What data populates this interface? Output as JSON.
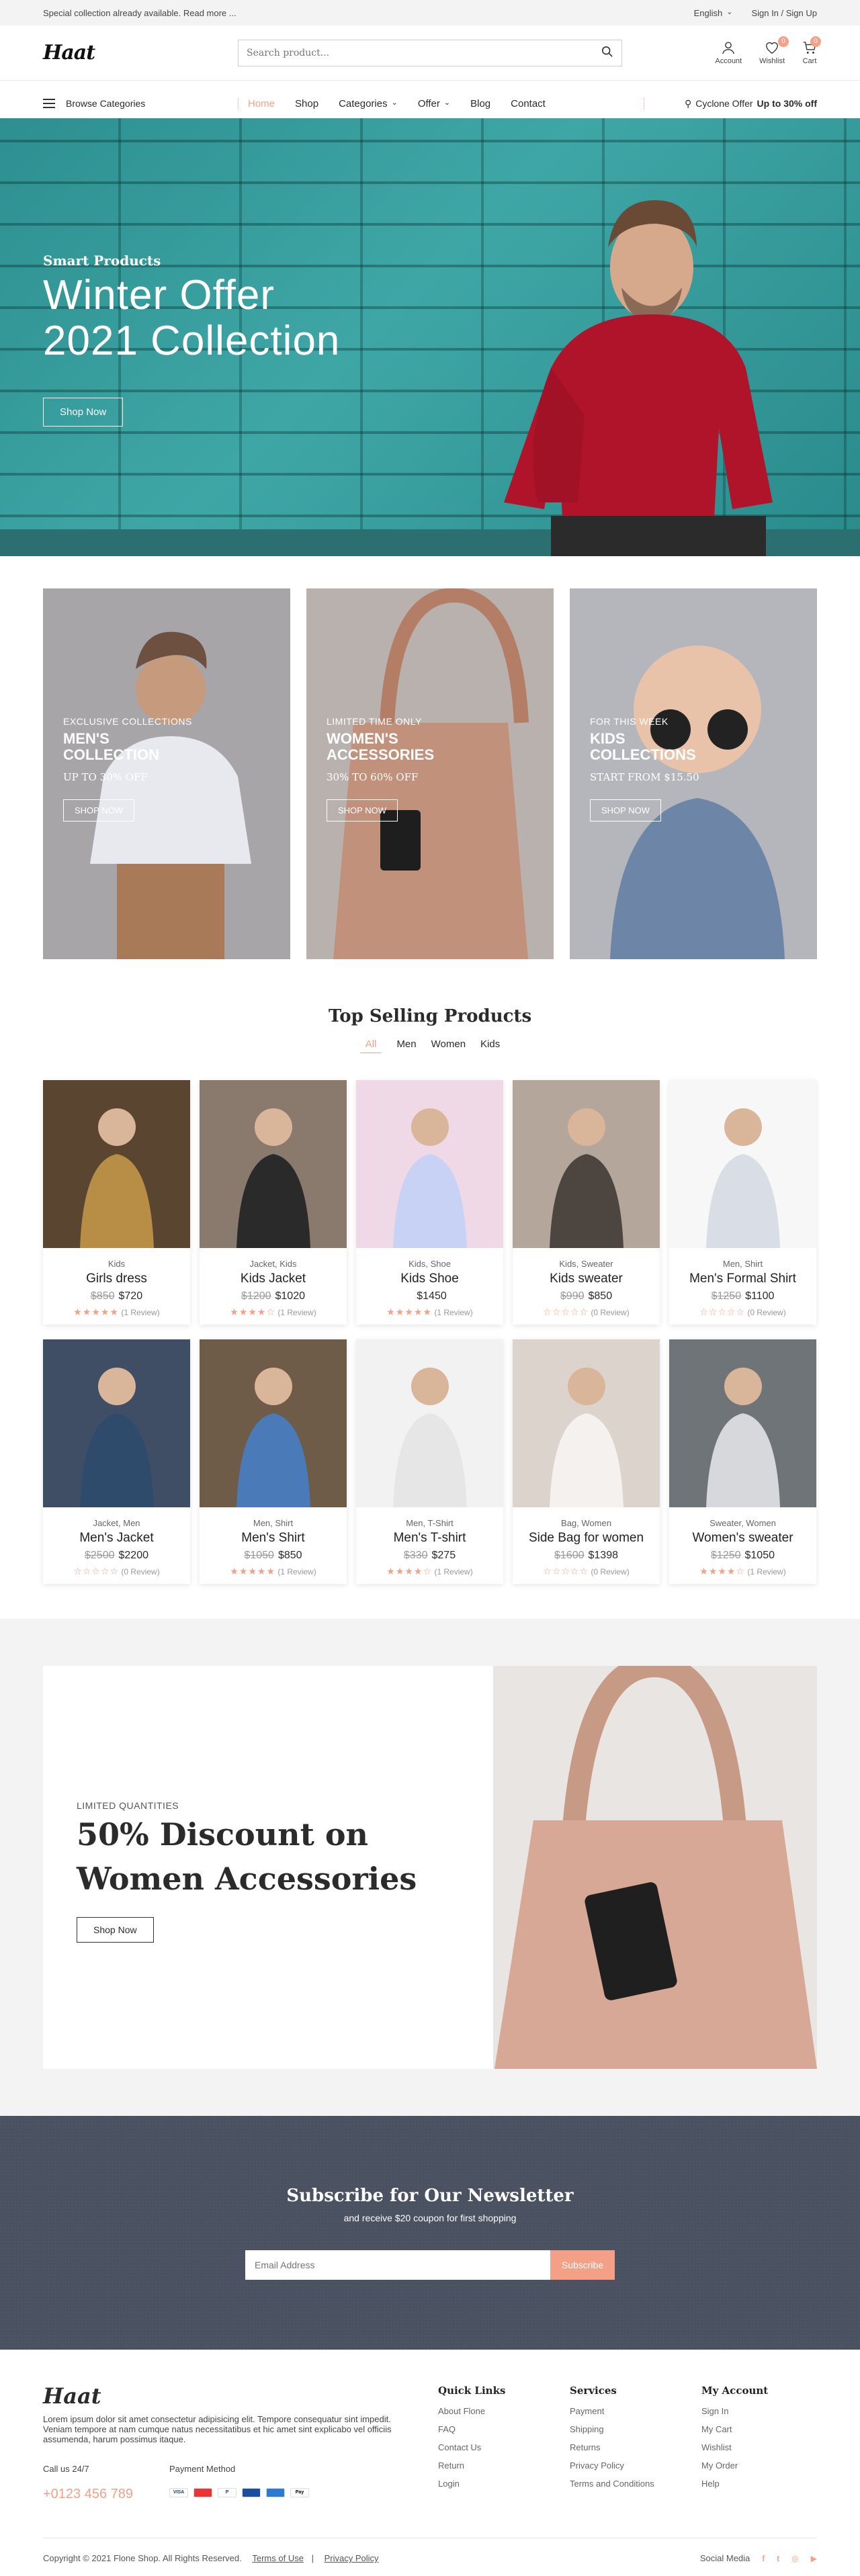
{
  "topbar": {
    "notice": "Special collection already available. Read more ...",
    "language": "English",
    "auth": "Sign In / Sign Up"
  },
  "header": {
    "logo": "Haat",
    "search_placeholder": "Search product...",
    "account": "Account",
    "wishlist": "Wishlist",
    "wishlist_count": "0",
    "cart": "Cart",
    "cart_count": "0"
  },
  "nav": {
    "browse": "Browse Categories",
    "items": [
      "Home",
      "Shop",
      "Categories",
      "Offer",
      "Blog",
      "Contact"
    ],
    "offer_prefix": "Cyclone Offer",
    "offer_strong": "Up to 30% off"
  },
  "hero": {
    "subtitle": "Smart Products",
    "title_line1": "Winter Offer",
    "title_line2": "2021 Collection",
    "button": "Shop Now"
  },
  "categories": [
    {
      "eyebrow": "EXCLUSIVE COLLECTIONS",
      "title": "MEN'S COLLECTION",
      "note": "UP TO 30% OFF",
      "button": "SHOP NOW"
    },
    {
      "eyebrow": "LIMITED TIME ONLY",
      "title": "WOMEN'S ACCESSORIES",
      "note": "30% TO 60% OFF",
      "button": "SHOP NOW"
    },
    {
      "eyebrow": "FOR THIS WEEK",
      "title": "KIDS COLLECTIONS",
      "note": "START FROM $15.50",
      "button": "SHOP NOW"
    }
  ],
  "top_selling": {
    "title": "Top Selling Products",
    "tabs": [
      "All",
      "Men",
      "Women",
      "Kids"
    ],
    "products": [
      {
        "category": "Kids",
        "name": "Girls dress",
        "old_price": "$850",
        "price": "$720",
        "stars": "★★★★★",
        "reviews": "(1 Review)"
      },
      {
        "category": "Jacket, Kids",
        "name": "Kids Jacket",
        "old_price": "$1200",
        "price": "$1020",
        "stars": "★★★★☆",
        "reviews": "(1 Review)"
      },
      {
        "category": "Kids, Shoe",
        "name": "Kids Shoe",
        "old_price": "",
        "price": "$1450",
        "stars": "★★★★★",
        "reviews": "(1 Review)"
      },
      {
        "category": "Kids, Sweater",
        "name": "Kids sweater",
        "old_price": "$990",
        "price": "$850",
        "stars": "☆☆☆☆☆",
        "reviews": "(0 Review)"
      },
      {
        "category": "Men, Shirt",
        "name": "Men's Formal Shirt",
        "old_price": "$1250",
        "price": "$1100",
        "stars": "☆☆☆☆☆",
        "reviews": "(0 Review)"
      },
      {
        "category": "Jacket, Men",
        "name": "Men's Jacket",
        "old_price": "$2500",
        "price": "$2200",
        "stars": "☆☆☆☆☆",
        "reviews": "(0 Review)"
      },
      {
        "category": "Men, Shirt",
        "name": "Men's Shirt",
        "old_price": "$1050",
        "price": "$850",
        "stars": "★★★★★",
        "reviews": "(1 Review)"
      },
      {
        "category": "Men, T-Shirt",
        "name": "Men's T-shirt",
        "old_price": "$330",
        "price": "$275",
        "stars": "★★★★☆",
        "reviews": "(1 Review)"
      },
      {
        "category": "Bag, Women",
        "name": "Side Bag for women",
        "old_price": "$1600",
        "price": "$1398",
        "stars": "☆☆☆☆☆",
        "reviews": "(0 Review)"
      },
      {
        "category": "Sweater, Women",
        "name": "Women's sweater",
        "old_price": "$1250",
        "price": "$1050",
        "stars": "★★★★☆",
        "reviews": "(1 Review)"
      }
    ]
  },
  "discount": {
    "eyebrow": "LIMITED QUANTITIES",
    "title_line1": "50% Discount on",
    "title_line2": "Women Accessories",
    "button": "Shop Now"
  },
  "newsletter": {
    "title": "Subscribe for Our Newsletter",
    "subtitle": "and receive $20 coupon for first shopping",
    "placeholder": "Email Address",
    "button": "Subscribe"
  },
  "footer": {
    "logo": "Haat",
    "about": "Lorem ipsum dolor sit amet consectetur adipisicing elit. Tempore consequatur sint impedit. Veniam tempore at nam cumque natus necessitatibus et hic amet sint explicabo vel officiis assumenda, harum possimus itaque.",
    "call_label": "Call us 24/7",
    "phone": "+0123 456 789",
    "payment_label": "Payment Method",
    "columns": [
      {
        "title": "Quick Links",
        "items": [
          "About Flone",
          "FAQ",
          "Contact Us",
          "Return",
          "Login"
        ]
      },
      {
        "title": "Services",
        "items": [
          "Payment",
          "Shipping",
          "Returns",
          "Privacy Policy",
          "Terms and Conditions"
        ]
      },
      {
        "title": "My Account",
        "items": [
          "Sign In",
          "My Cart",
          "Wishlist",
          "My Order",
          "Help"
        ]
      }
    ],
    "copyright": "Copyright © 2021 Flone Shop. All Rights Reserved.",
    "terms": "Terms of Use",
    "privacy": "Privacy Policy",
    "social_label": "Social Media"
  },
  "colors": {
    "accent": "#f4a087",
    "hero_teal": "#3a9d9e",
    "newsletter": "#4a5160"
  }
}
